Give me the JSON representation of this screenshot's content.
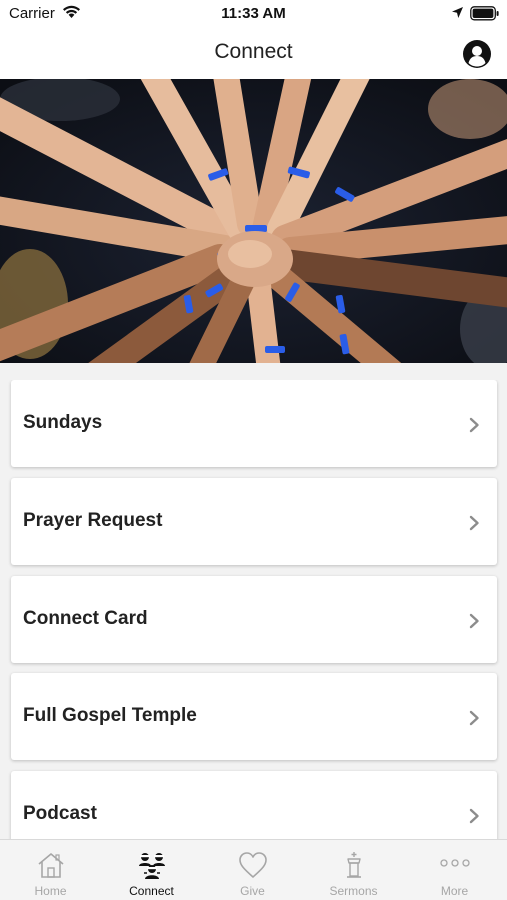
{
  "status_bar": {
    "carrier": "Carrier",
    "time": "11:33 AM"
  },
  "nav": {
    "title": "Connect"
  },
  "hero": {
    "description_icon": "unity-hands-image"
  },
  "items": [
    {
      "label": "Sundays"
    },
    {
      "label": "Prayer Request"
    },
    {
      "label": "Connect Card"
    },
    {
      "label": "Full Gospel Temple"
    },
    {
      "label": "Podcast"
    }
  ],
  "tabs": [
    {
      "label": "Home",
      "icon": "home-icon",
      "active": false
    },
    {
      "label": "Connect",
      "icon": "connect-icon",
      "active": true
    },
    {
      "label": "Give",
      "icon": "heart-icon",
      "active": false
    },
    {
      "label": "Sermons",
      "icon": "pulpit-icon",
      "active": false
    },
    {
      "label": "More",
      "icon": "more-icon",
      "active": false
    }
  ],
  "colors": {
    "active_tab": "#111111",
    "inactive_tab": "#a6a6a6",
    "background": "#f2f2f2"
  }
}
